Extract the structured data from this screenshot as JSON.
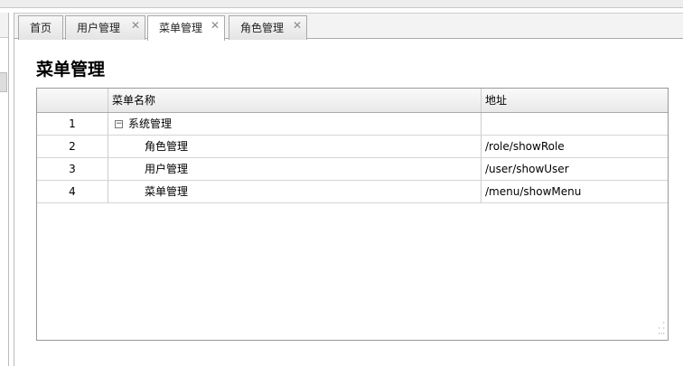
{
  "tabs": [
    {
      "label": "首页",
      "closable": false
    },
    {
      "label": "用户管理",
      "closable": true
    },
    {
      "label": "菜单管理",
      "closable": true,
      "active": true
    },
    {
      "label": "角色管理",
      "closable": true
    }
  ],
  "close_glyph": "✕",
  "page_title": "菜单管理",
  "grid": {
    "columns": [
      "",
      "菜单名称",
      "地址"
    ],
    "rows": [
      {
        "num": "1",
        "name": "系统管理",
        "url": "",
        "expand": "−"
      },
      {
        "num": "2",
        "name": "角色管理",
        "url": "/role/showRole"
      },
      {
        "num": "3",
        "name": "用户管理",
        "url": "/user/showUser"
      },
      {
        "num": "4",
        "name": "菜单管理",
        "url": "/menu/showMenu"
      }
    ]
  }
}
